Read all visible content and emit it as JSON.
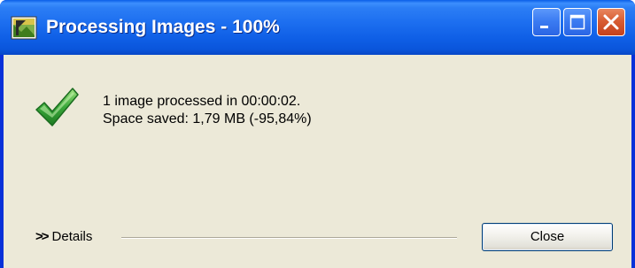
{
  "window": {
    "title": "Processing Images - 100%",
    "app_icon": "image-optimizer-app-icon",
    "titlebar_color": "#0a55db",
    "controls": {
      "minimize_icon": "minimize-icon",
      "maximize_icon": "maximize-icon",
      "close_icon": "close-icon"
    }
  },
  "result": {
    "status_icon": "checkmark-icon",
    "status_color": "#3aa83a",
    "summary_line": "1 image processed in 00:00:02.",
    "space_saved_line": "Space saved: 1,79 MB (-95,84%)"
  },
  "footer": {
    "details_label": "Details",
    "close_label": "Close"
  }
}
